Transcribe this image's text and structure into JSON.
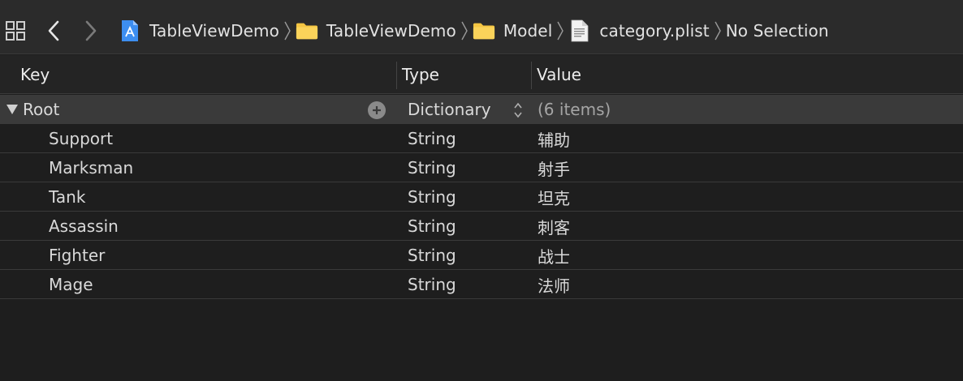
{
  "jumpbar": {
    "crumbs": [
      {
        "label": "TableViewDemo",
        "icon": "xcode-project-icon"
      },
      {
        "label": "TableViewDemo",
        "icon": "folder-icon"
      },
      {
        "label": "Model",
        "icon": "folder-icon"
      },
      {
        "label": "category.plist",
        "icon": "plist-file-icon"
      },
      {
        "label": "No Selection",
        "icon": ""
      }
    ],
    "colors": {
      "folder": "#f5c542",
      "project_blue": "#2f7de0"
    }
  },
  "table": {
    "columns": {
      "key": "Key",
      "type": "Type",
      "value": "Value"
    },
    "root": {
      "key": "Root",
      "type": "Dictionary",
      "value": "(6 items)"
    },
    "rows": [
      {
        "key": "Support",
        "type": "String",
        "value": "辅助"
      },
      {
        "key": "Marksman",
        "type": "String",
        "value": "射手"
      },
      {
        "key": "Tank",
        "type": "String",
        "value": "坦克"
      },
      {
        "key": "Assassin",
        "type": "String",
        "value": "刺客"
      },
      {
        "key": "Fighter",
        "type": "String",
        "value": "战士"
      },
      {
        "key": "Mage",
        "type": "String",
        "value": "法师"
      }
    ]
  }
}
